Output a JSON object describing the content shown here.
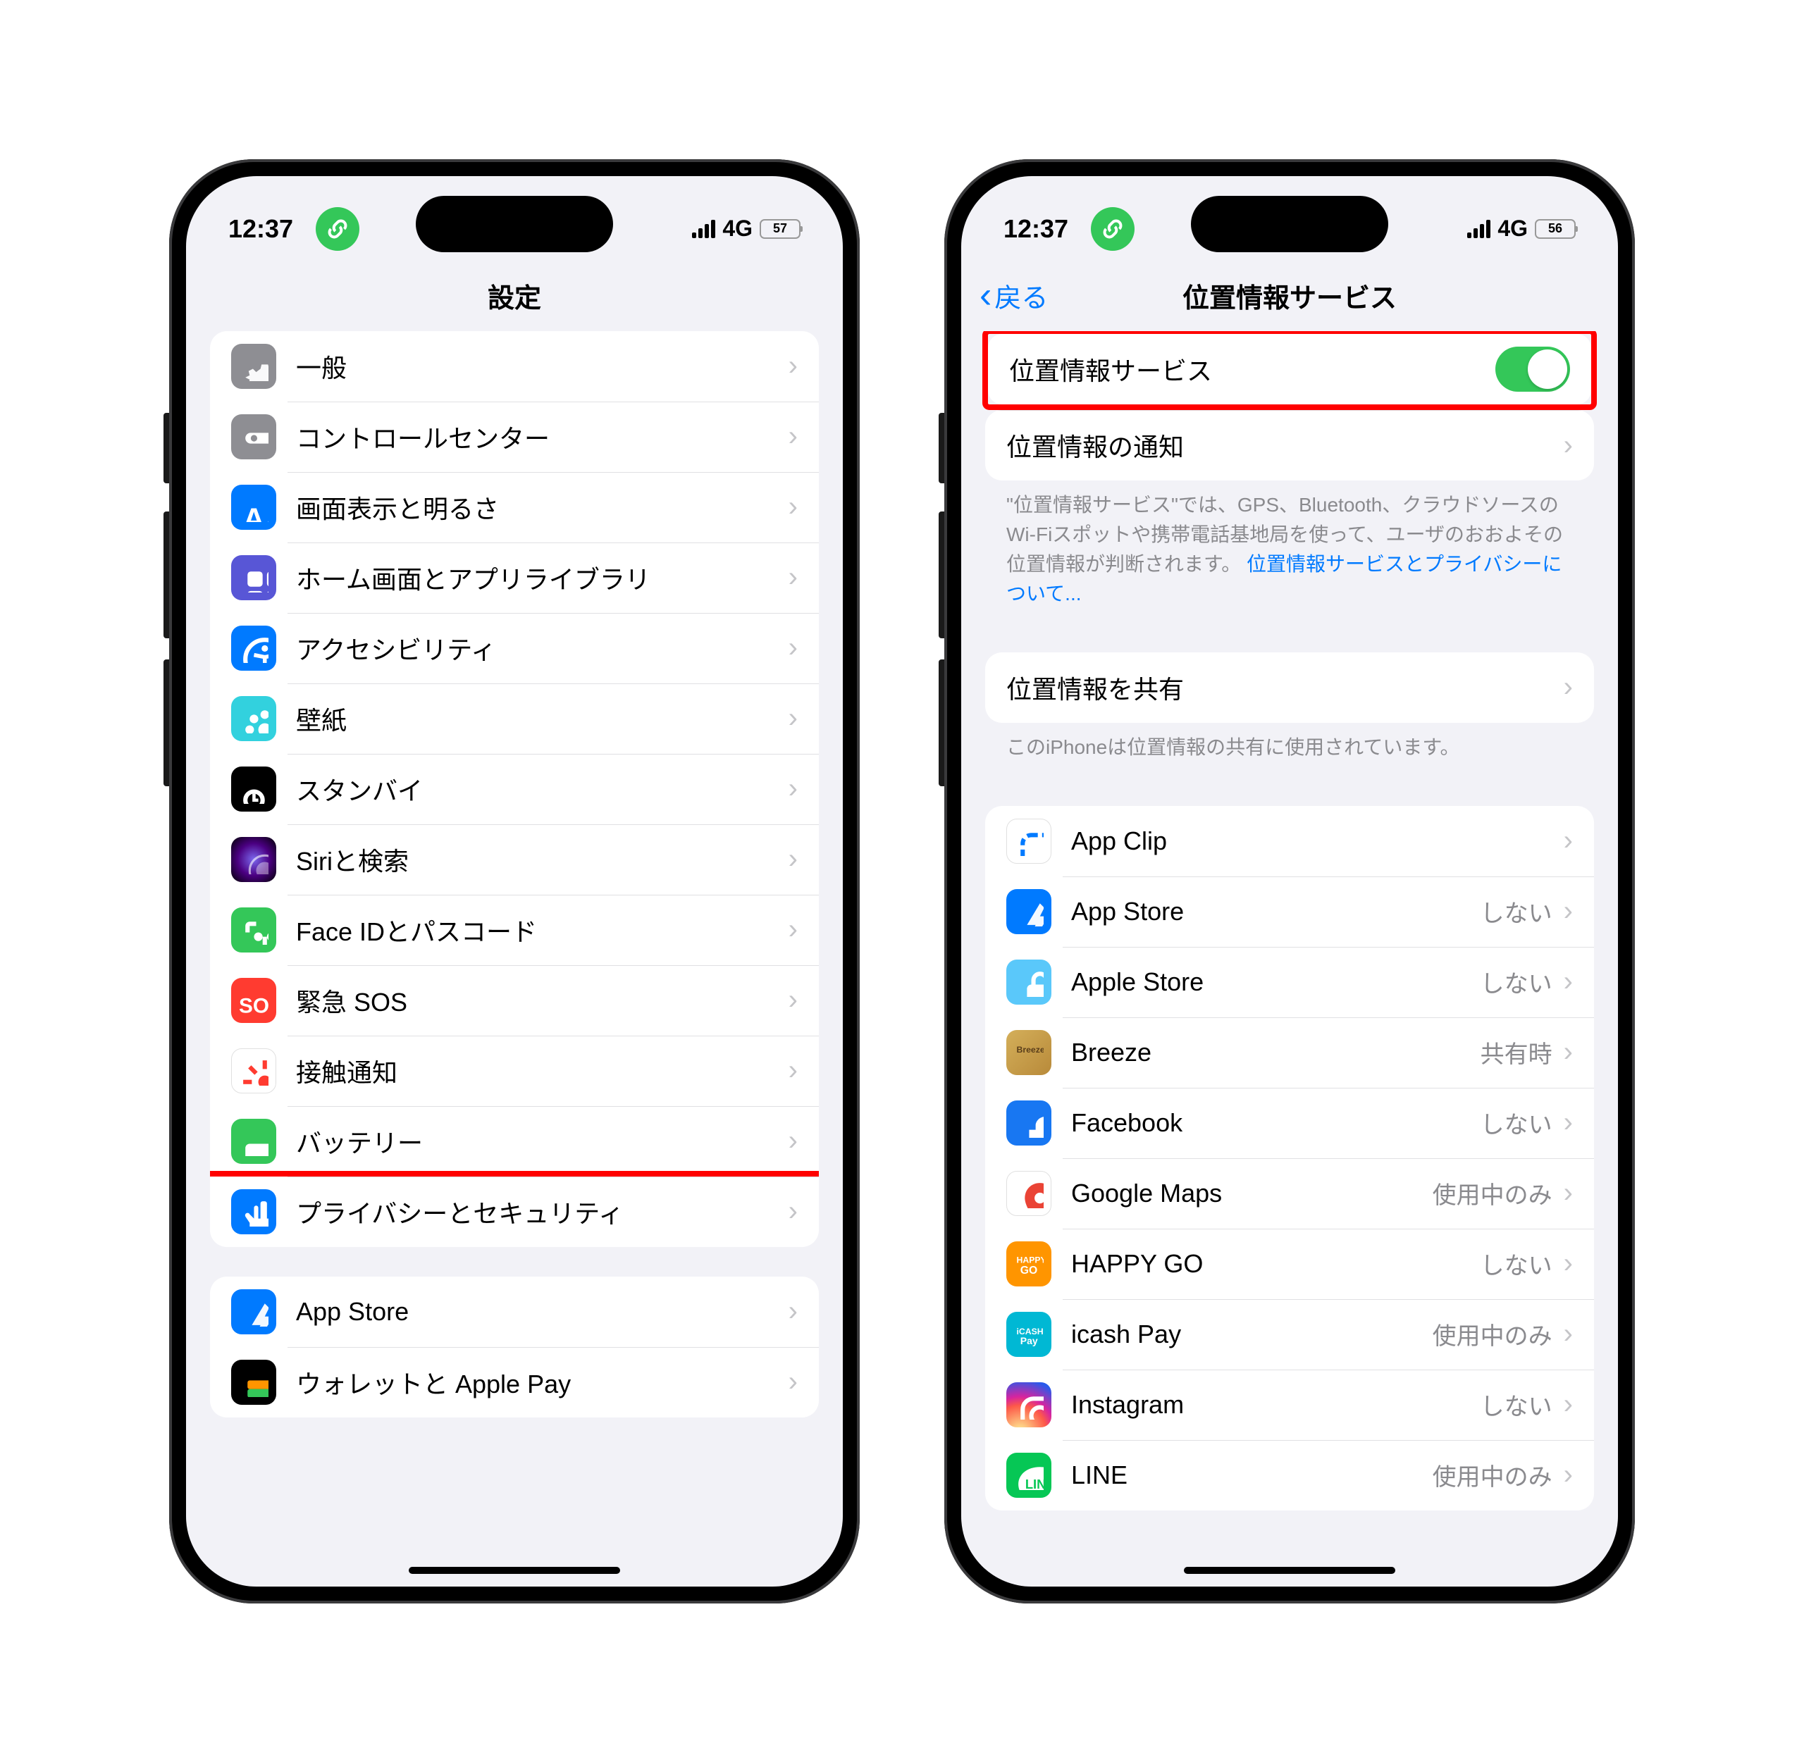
{
  "phone1": {
    "status": {
      "time": "12:37",
      "network": "4G",
      "battery": "57"
    },
    "title": "設定",
    "group1": [
      {
        "icon": "gear-icon",
        "iconClass": "ic-gray",
        "label": "一般"
      },
      {
        "icon": "toggles-icon",
        "iconClass": "ic-gray",
        "label": "コントロールセンター"
      },
      {
        "icon": "brightness-icon",
        "iconClass": "ic-blue",
        "label": "画面表示と明るさ"
      },
      {
        "icon": "grid-icon",
        "iconClass": "ic-purple",
        "label": "ホーム画面とアプリライブラリ"
      },
      {
        "icon": "accessibility-icon",
        "iconClass": "ic-blue",
        "label": "アクセシビリティ"
      },
      {
        "icon": "wallpaper-icon",
        "iconClass": "ic-teal",
        "label": "壁紙"
      },
      {
        "icon": "standby-icon",
        "iconClass": "ic-black",
        "label": "スタンバイ"
      },
      {
        "icon": "siri-icon",
        "iconClass": "ic-siri",
        "label": "Siriと検索"
      },
      {
        "icon": "faceid-icon",
        "iconClass": "ic-green",
        "label": "Face IDとパスコード"
      },
      {
        "icon": "sos-icon",
        "iconClass": "ic-red",
        "label": "緊急 SOS"
      },
      {
        "icon": "exposure-icon",
        "iconClass": "ic-white",
        "label": "接触通知"
      },
      {
        "icon": "battery-icon",
        "iconClass": "ic-green",
        "label": "バッテリー"
      },
      {
        "icon": "hand-icon",
        "iconClass": "ic-blue",
        "label": "プライバシーとセキュリティ",
        "highlighted": true
      }
    ],
    "group2": [
      {
        "icon": "appstore-icon",
        "iconClass": "ic-blue",
        "label": "App Store"
      },
      {
        "icon": "wallet-icon",
        "iconClass": "ic-black",
        "label": "ウォレットと Apple Pay"
      }
    ]
  },
  "phone2": {
    "status": {
      "time": "12:37",
      "network": "4G",
      "battery": "56"
    },
    "back": "戻る",
    "title": "位置情報サービス",
    "toggle_row": {
      "label": "位置情報サービス",
      "on": true
    },
    "alerts_row": {
      "label": "位置情報の通知"
    },
    "footer1_a": "\"位置情報サービス\"では、GPS、Bluetooth、クラウドソースのWi-Fiスポットや携帯電話基地局を使って、ユーザのおおよその位置情報が判断されます。 ",
    "footer1_link": "位置情報サービスとプライバシーについて...",
    "share_row": {
      "label": "位置情報を共有"
    },
    "footer2": "このiPhoneは位置情報の共有に使用されています。",
    "apps": [
      {
        "icon": "appclip-icon",
        "iconClass": "ic-white",
        "label": "App Clip",
        "detail": ""
      },
      {
        "icon": "appstore-icon",
        "iconClass": "ic-blue",
        "label": "App Store",
        "detail": "しない"
      },
      {
        "icon": "applestore-icon",
        "iconClass": "ic-lightblue",
        "label": "Apple Store",
        "detail": "しない"
      },
      {
        "icon": "breeze-icon",
        "iconClass": "ic-gold",
        "label": "Breeze",
        "detail": "共有時"
      },
      {
        "icon": "facebook-icon",
        "iconClass": "ic-fb",
        "label": "Facebook",
        "detail": "しない"
      },
      {
        "icon": "gmaps-icon",
        "iconClass": "ic-white",
        "label": "Google Maps",
        "detail": "使用中のみ"
      },
      {
        "icon": "happygo-icon",
        "iconClass": "ic-orange",
        "label": "HAPPY GO",
        "detail": "しない"
      },
      {
        "icon": "icash-icon",
        "iconClass": "ic-icash",
        "label": "icash Pay",
        "detail": "使用中のみ"
      },
      {
        "icon": "instagram-icon",
        "iconClass": "ic-insta",
        "label": "Instagram",
        "detail": "しない"
      },
      {
        "icon": "line-icon",
        "iconClass": "ic-line",
        "label": "LINE",
        "detail": "使用中のみ"
      }
    ]
  }
}
